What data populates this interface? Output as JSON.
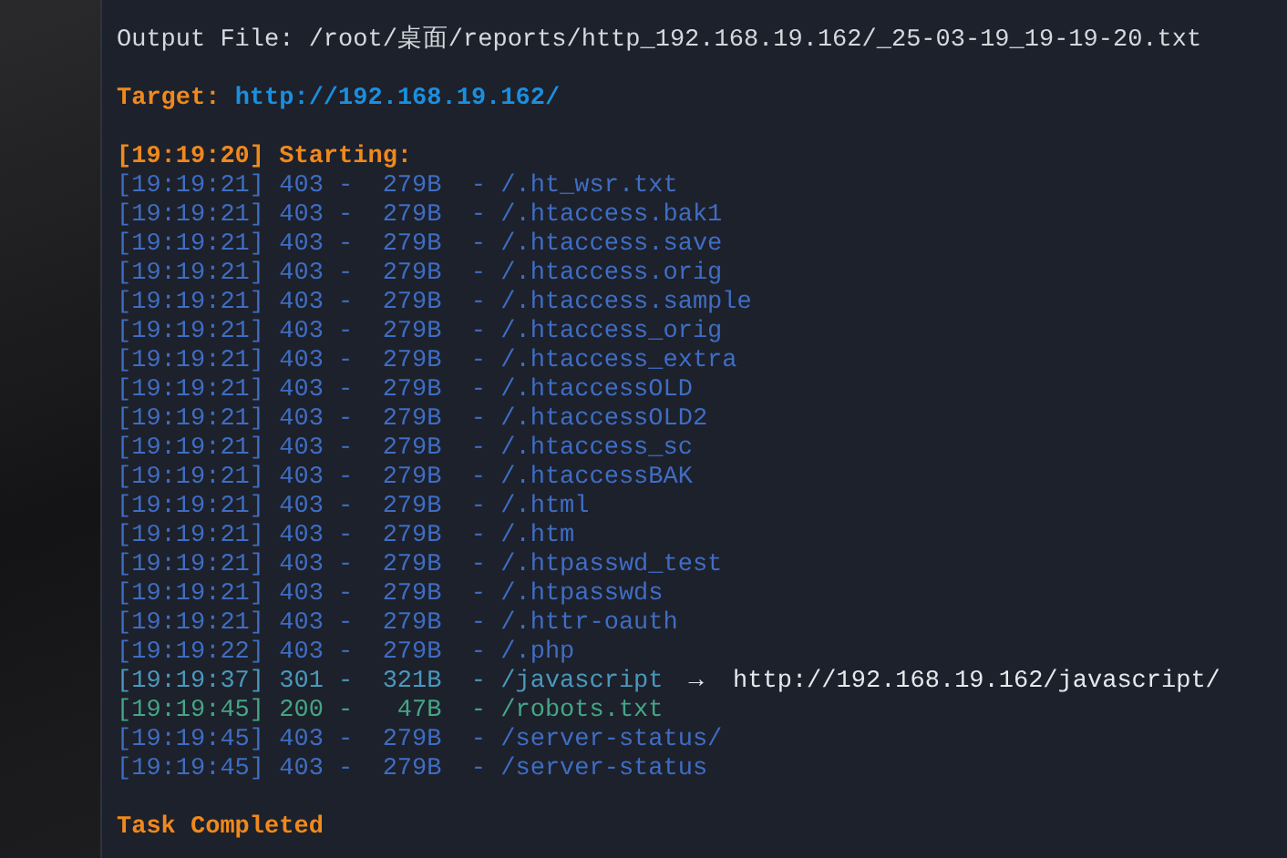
{
  "output_file": "Output File: /root/桌面/reports/http_192.168.19.162/_25-03-19_19-19-20.txt",
  "target": {
    "label": "Target:",
    "url": "http://192.168.19.162/"
  },
  "start": "[19:19:20] Starting:",
  "rows": [
    {
      "kind": "forbidden",
      "line": "[19:19:21] 403 -  279B  - /.ht_wsr.txt"
    },
    {
      "kind": "forbidden",
      "line": "[19:19:21] 403 -  279B  - /.htaccess.bak1"
    },
    {
      "kind": "forbidden",
      "line": "[19:19:21] 403 -  279B  - /.htaccess.save"
    },
    {
      "kind": "forbidden",
      "line": "[19:19:21] 403 -  279B  - /.htaccess.orig"
    },
    {
      "kind": "forbidden",
      "line": "[19:19:21] 403 -  279B  - /.htaccess.sample"
    },
    {
      "kind": "forbidden",
      "line": "[19:19:21] 403 -  279B  - /.htaccess_orig"
    },
    {
      "kind": "forbidden",
      "line": "[19:19:21] 403 -  279B  - /.htaccess_extra"
    },
    {
      "kind": "forbidden",
      "line": "[19:19:21] 403 -  279B  - /.htaccessOLD"
    },
    {
      "kind": "forbidden",
      "line": "[19:19:21] 403 -  279B  - /.htaccessOLD2"
    },
    {
      "kind": "forbidden",
      "line": "[19:19:21] 403 -  279B  - /.htaccess_sc"
    },
    {
      "kind": "forbidden",
      "line": "[19:19:21] 403 -  279B  - /.htaccessBAK"
    },
    {
      "kind": "forbidden",
      "line": "[19:19:21] 403 -  279B  - /.html"
    },
    {
      "kind": "forbidden",
      "line": "[19:19:21] 403 -  279B  - /.htm"
    },
    {
      "kind": "forbidden",
      "line": "[19:19:21] 403 -  279B  - /.htpasswd_test"
    },
    {
      "kind": "forbidden",
      "line": "[19:19:21] 403 -  279B  - /.htpasswds"
    },
    {
      "kind": "forbidden",
      "line": "[19:19:21] 403 -  279B  - /.httr-oauth"
    },
    {
      "kind": "forbidden",
      "line": "[19:19:22] 403 -  279B  - /.php"
    },
    {
      "kind": "redirect",
      "line": "[19:19:37] 301 -  321B  - /javascript",
      "redirect": "→  http://192.168.19.162/javascript/"
    },
    {
      "kind": "ok",
      "line": "[19:19:45] 200 -   47B  - /robots.txt"
    },
    {
      "kind": "forbidden",
      "line": "[19:19:45] 403 -  279B  - /server-status/"
    },
    {
      "kind": "forbidden",
      "line": "[19:19:45] 403 -  279B  - /server-status"
    }
  ],
  "done": "Task Completed"
}
